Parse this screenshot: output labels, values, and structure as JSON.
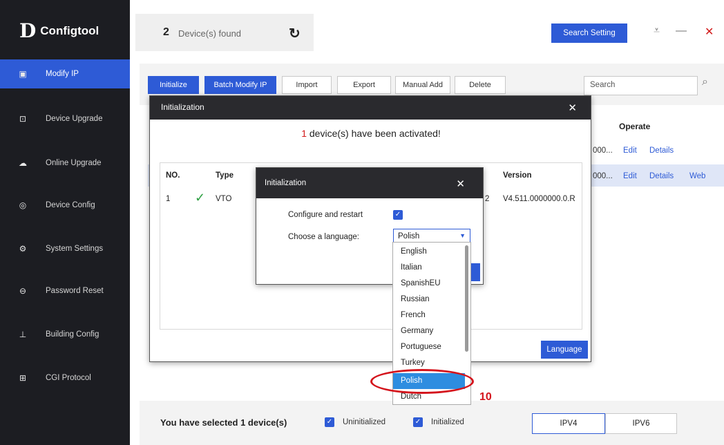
{
  "app": {
    "name": "Configtool",
    "logo_mark": "D"
  },
  "sidebar": {
    "items": [
      {
        "label": "Modify IP",
        "icon": "ip-icon",
        "glyph": "▣",
        "active": true
      },
      {
        "label": "Device Upgrade",
        "icon": "upgrade-icon",
        "glyph": "⊡",
        "active": false
      },
      {
        "label": "Online Upgrade",
        "icon": "cloud-upgrade-icon",
        "glyph": "☁",
        "active": false
      },
      {
        "label": "Device Config",
        "icon": "device-config-icon",
        "glyph": "◎",
        "active": false
      },
      {
        "label": "System Settings",
        "icon": "settings-icon",
        "glyph": "⚙",
        "active": false
      },
      {
        "label": "Password Reset",
        "icon": "lock-icon",
        "glyph": "⊖",
        "active": false
      },
      {
        "label": "Building Config",
        "icon": "building-icon",
        "glyph": "⊥",
        "active": false
      },
      {
        "label": "CGI Protocol",
        "icon": "protocol-icon",
        "glyph": "⊞",
        "active": false
      }
    ]
  },
  "header": {
    "device_count": "2",
    "device_found_label": "Device(s) found",
    "search_setting_label": "Search Setting"
  },
  "toolbar": {
    "initialize": "Initialize",
    "batch_modify_ip": "Batch Modify IP",
    "import": "Import",
    "export": "Export",
    "manual_add": "Manual Add",
    "delete": "Delete",
    "search_placeholder": "Search"
  },
  "table": {
    "operate_header": "Operate",
    "rows": [
      {
        "frag": "000...",
        "edit": "Edit",
        "details": "Details",
        "web": ""
      },
      {
        "frag": "000...",
        "edit": "Edit",
        "details": "Details",
        "web": "Web"
      }
    ]
  },
  "init_dialog": {
    "title": "Initialization",
    "activated_count": "1",
    "activated_text": "device(s) have been activated!",
    "columns": {
      "no": "NO.",
      "type": "Type",
      "version": "Version"
    },
    "rows": [
      {
        "no": "1",
        "type": "VTO",
        "frag": "2",
        "version": "V4.511.0000000.0.R"
      }
    ],
    "language_button": "Language"
  },
  "lang_dialog": {
    "title": "Initialization",
    "configure_label": "Configure and restart",
    "configure_checked": true,
    "choose_language_label": "Choose a language:",
    "selected_language": "Polish"
  },
  "language_options": [
    "English",
    "Italian",
    "SpanishEU",
    "Russian",
    "French",
    "Germany",
    "Portuguese",
    "Turkey",
    "Polish",
    "Dutch"
  ],
  "highlighted_option": "Polish",
  "annotation": {
    "step_number": "10",
    "color": "#d4141c"
  },
  "footer": {
    "selected_text": "You have selected 1  device(s)",
    "uninitialized_label": "Uninitialized",
    "initialized_label": "Initialized",
    "ipv4": "IPV4",
    "ipv6": "IPV6"
  },
  "colors": {
    "accent": "#2e5bd6",
    "sidebar_bg": "#1c1d22",
    "dialog_header": "#2a2a2e",
    "dropdown_highlight": "#2e8de0"
  }
}
